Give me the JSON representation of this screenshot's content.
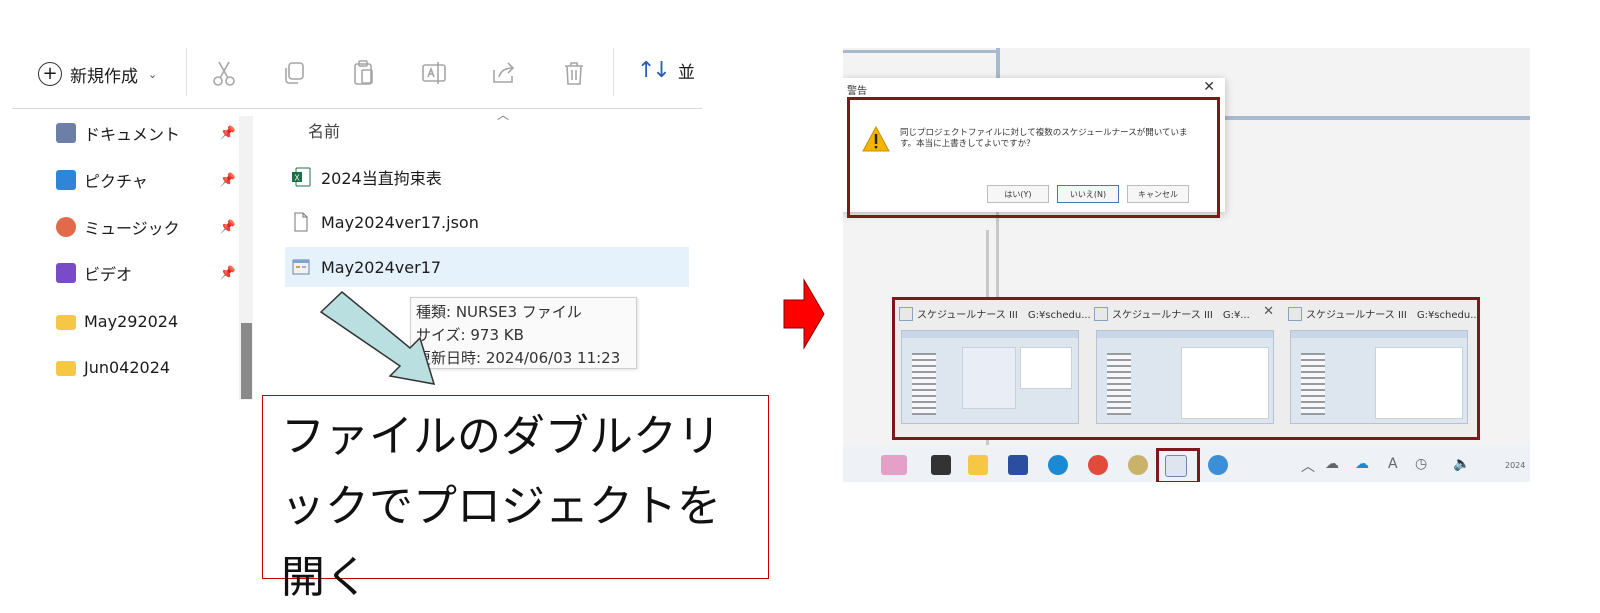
{
  "explorer": {
    "toolbar": {
      "new_label": "新規作成",
      "sort_label": "並",
      "icons": [
        "cut-icon",
        "copy-icon",
        "paste-icon",
        "rename-icon",
        "share-icon",
        "delete-icon"
      ]
    },
    "nav": [
      {
        "label": "ドキュメント",
        "icon": "documents-icon",
        "color": "#6b7fa7",
        "pinned": true
      },
      {
        "label": "ピクチャ",
        "icon": "pictures-icon",
        "color": "#2f86d8",
        "pinned": true
      },
      {
        "label": "ミュージック",
        "icon": "music-icon",
        "color": "#e06a4a",
        "pinned": true
      },
      {
        "label": "ビデオ",
        "icon": "videos-icon",
        "color": "#7a4bc8",
        "pinned": true
      },
      {
        "label": "May292024",
        "icon": "folder-icon",
        "color": "#f6c744",
        "pinned": false
      },
      {
        "label": "Jun042024",
        "icon": "folder-icon",
        "color": "#f6c744",
        "pinned": false
      }
    ],
    "column_header": "名前",
    "files": [
      {
        "name": "2024当直拘束表",
        "icon": "excel-icon",
        "selected": false
      },
      {
        "name": "May2024ver17.json",
        "icon": "document-icon",
        "selected": false
      },
      {
        "name": "May2024ver17",
        "icon": "app-file-icon",
        "selected": true
      }
    ],
    "tooltip": {
      "type_line": "種類: NURSE3 ファイル",
      "size_line": "サイズ: 973 KB",
      "date_line": "更新日時: 2024/06/03 11:23"
    }
  },
  "callout": {
    "text": "ファイルのダブルクリックでプロジェクトを開く"
  },
  "dialog": {
    "title": "警告",
    "message": "同じプロジェクトファイルに対して複数のスケジュールナースが開いています。本当に上書きしてよいですか？",
    "buttons": [
      "はい(Y)",
      "いいえ(N)",
      "キャンセル"
    ]
  },
  "thumbnails": [
    {
      "title": "スケジュールナース III　G:¥schedu..."
    },
    {
      "title": "スケジュールナース III　G:¥..."
    },
    {
      "title": "スケジュールナース III　G:¥schedu..."
    }
  ],
  "taskbar": {
    "clock_fragment": "2024"
  },
  "colors": {
    "highlight_border": "#7a1a1a",
    "callout_border": "#c00000",
    "arrow_fill": "#b9dfe0",
    "red_arrow": "#ff0000"
  }
}
